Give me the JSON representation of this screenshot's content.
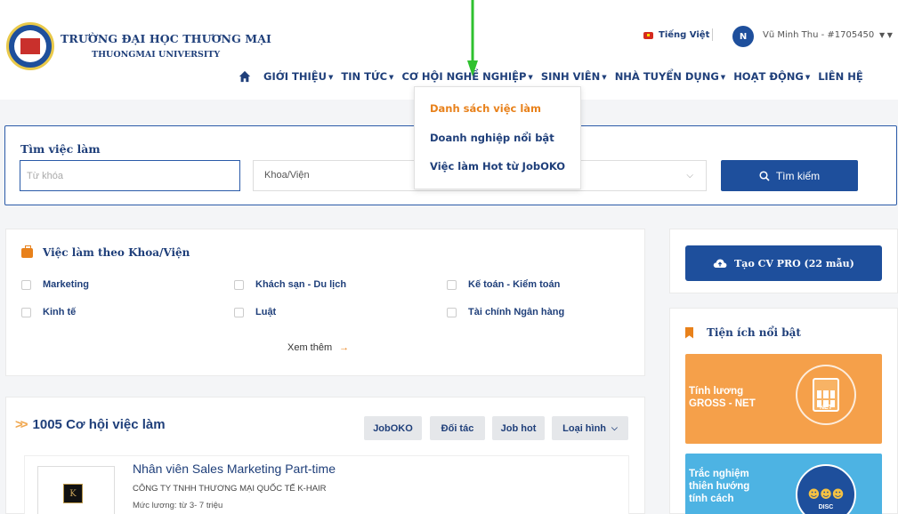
{
  "header": {
    "university_name": "TRƯỜNG ĐẠI HỌC THƯƠNG MẠI",
    "university_sub": "THUONGMAI UNIVERSITY",
    "language": "Tiếng Việt",
    "avatar_initial": "N",
    "username": "Vũ Minh Thu - #1705450"
  },
  "nav": {
    "items": [
      "GIỚI THIỆU",
      "TIN TỨC",
      "CƠ HỘI NGHỀ NGHIỆP",
      "SINH VIÊN",
      "NHÀ TUYỂN DỤNG",
      "HOẠT ĐỘNG",
      "LIÊN HỆ"
    ]
  },
  "dropdown": {
    "items": [
      "Danh sách việc làm",
      "Doanh nghiệp nổi bật",
      "Việc làm Hot từ JobOKO"
    ]
  },
  "search": {
    "title": "Tìm việc làm",
    "keyword_placeholder": "Từ khóa",
    "keyword_value": "",
    "faculty_selected": "Khoa/Viện",
    "button_label": "Tìm kiếm"
  },
  "faculty": {
    "title": "Việc làm theo Khoa/Viện",
    "items": [
      "Marketing",
      "Khách sạn - Du lịch",
      "Kế toán - Kiểm toán",
      "Kinh tế",
      "Luật",
      "Tài chính Ngân hàng"
    ],
    "see_more": "Xem thêm"
  },
  "jobs": {
    "title": "1005 Cơ hội việc làm",
    "filters": [
      "JobOKO",
      "Đối tác",
      "Job hot",
      "Loại hình"
    ],
    "first_job": {
      "title": "Nhân viên Sales Marketing Part-time",
      "company": "CÔNG TY TNHH THƯƠNG MẠI QUỐC TẾ K-HAIR",
      "salary": "Mức lương: từ 3- 7 triệu",
      "logo_letter": "K"
    }
  },
  "sidebar": {
    "cv_button": "Tạo CV PRO (22 mẫu)",
    "utilities_title": "Tiện ích nổi bật",
    "tile_salary": "Tính lương\nGROSS - NET",
    "tile_salary_caption": "NET",
    "tile_personality": "Trắc nghiệm\nthiên hướng\ntính cách",
    "tile_personality_caption": "DISC"
  },
  "colors": {
    "primary": "#1e4f9c",
    "accent": "#e8811b",
    "annotation_arrow": "#2fc12f"
  }
}
